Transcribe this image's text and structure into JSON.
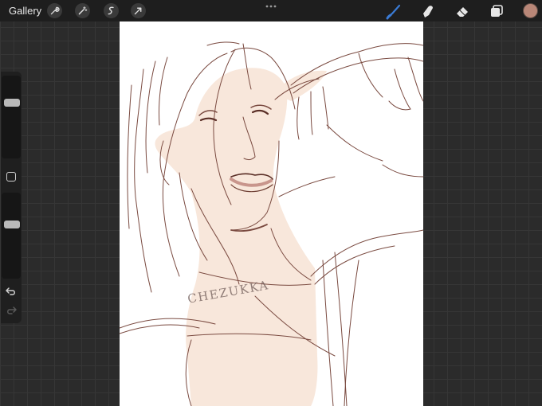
{
  "toolbar": {
    "gallery_label": "Gallery",
    "left_icons": [
      "wrench-icon",
      "magic-wand-icon",
      "selection-icon",
      "transform-arrow-icon"
    ],
    "center_icon": "more-dots-icon",
    "right_icons": [
      "brush-icon",
      "smudge-icon",
      "eraser-icon",
      "layers-icon"
    ],
    "active_tool": "brush-icon",
    "active_color": "#b98778",
    "accent_color": "#3a7bd5"
  },
  "sidebar": {
    "size_slider": {
      "level": 0.7
    },
    "opacity_slider": {
      "level": 0.65
    },
    "icons": [
      "modify-square-icon",
      "undo-icon",
      "redo-icon"
    ]
  },
  "canvas": {
    "watermark": "CHEZUKKA",
    "skin_color": "#f7e6da",
    "line_color": "#6b3b30"
  }
}
